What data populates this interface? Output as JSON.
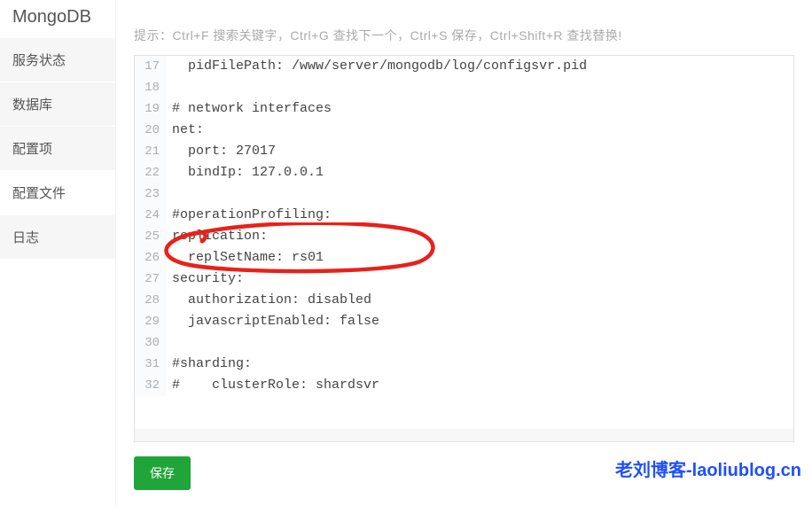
{
  "app": {
    "title": "MongoDB"
  },
  "sidebar": {
    "items": [
      {
        "label": "服务状态"
      },
      {
        "label": "数据库"
      },
      {
        "label": "配置项"
      },
      {
        "label": "配置文件"
      },
      {
        "label": "日志"
      }
    ],
    "active_index": 3
  },
  "hint": "提示：Ctrl+F 搜索关键字，Ctrl+G 查找下一个，Ctrl+S 保存，Ctrl+Shift+R 查找替换!",
  "editor": {
    "first_line": 17,
    "lines": [
      "  pidFilePath: /www/server/mongodb/log/configsvr.pid",
      "",
      "# network interfaces",
      "net:",
      "  port: 27017",
      "  bindIp: 127.0.0.1",
      "",
      "#operationProfiling:",
      "replication:",
      "  replSetName: rs01 ",
      "security:",
      "  authorization: disabled",
      "  javascriptEnabled: false",
      "",
      "#sharding:",
      "#    clusterRole: shardsvr"
    ]
  },
  "buttons": {
    "save": "保存"
  },
  "colors": {
    "accent_green": "#20a53a",
    "annotation_red": "#e8211a",
    "watermark_blue": "#1e4fff"
  },
  "watermark": "老刘博客-laoliublog.cn"
}
